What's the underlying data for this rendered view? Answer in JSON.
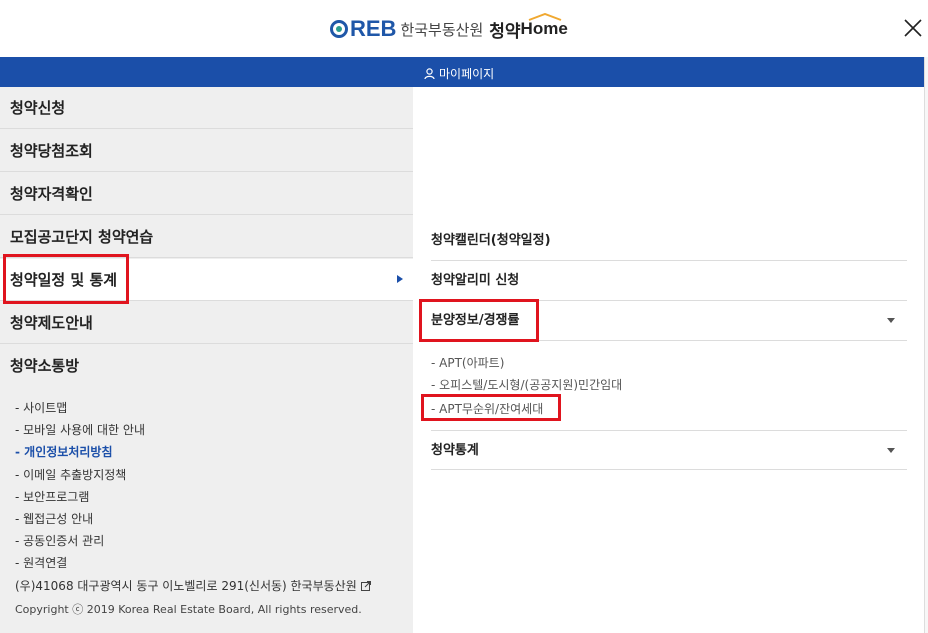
{
  "header": {
    "logo_reb": "REB",
    "logo_org": "한국부동산원",
    "logo_app": "청약",
    "logo_home": "Home",
    "close_icon": "close-icon"
  },
  "topbar": {
    "mypage_label": "마이페이지",
    "user_icon": "user-icon"
  },
  "left_menu": {
    "items": [
      {
        "label": "청약신청"
      },
      {
        "label": "청약당첨조회"
      },
      {
        "label": "청약자격확인"
      },
      {
        "label": "모집공고단지 청약연습"
      },
      {
        "label": "청약일정 및 통계"
      },
      {
        "label": "청약제도안내"
      },
      {
        "label": "청약소통방"
      }
    ],
    "links": [
      "- 사이트맵",
      "- 모바일 사용에 대한 안내",
      "- 개인정보처리방침",
      "- 이메일 추출방지정책",
      "- 보안프로그램",
      "- 웹접근성 안내",
      "- 공동인증서 관리",
      "- 원격연결"
    ],
    "address": "(우)41068 대구광역시 동구 이노벨리로 291(신서동) 한국부동산원",
    "copyright": "Copyright ⓒ 2019 Korea Real Estate Board, All rights reserved."
  },
  "right_menu": {
    "items": [
      {
        "label": "청약캘린더(청약일정)"
      },
      {
        "label": "청약알리미 신청"
      },
      {
        "label": "분양정보/경쟁률"
      },
      {
        "label": "청약통계"
      }
    ],
    "subitems": [
      "- APT(아파트)",
      "- 오피스텔/도시형/(공공지원)민간임대",
      "- APT무순위/잔여세대"
    ]
  },
  "colors": {
    "brand_blue": "#1b4fa9",
    "highlight_red": "#e0141e",
    "panel_gray": "#efefef"
  }
}
